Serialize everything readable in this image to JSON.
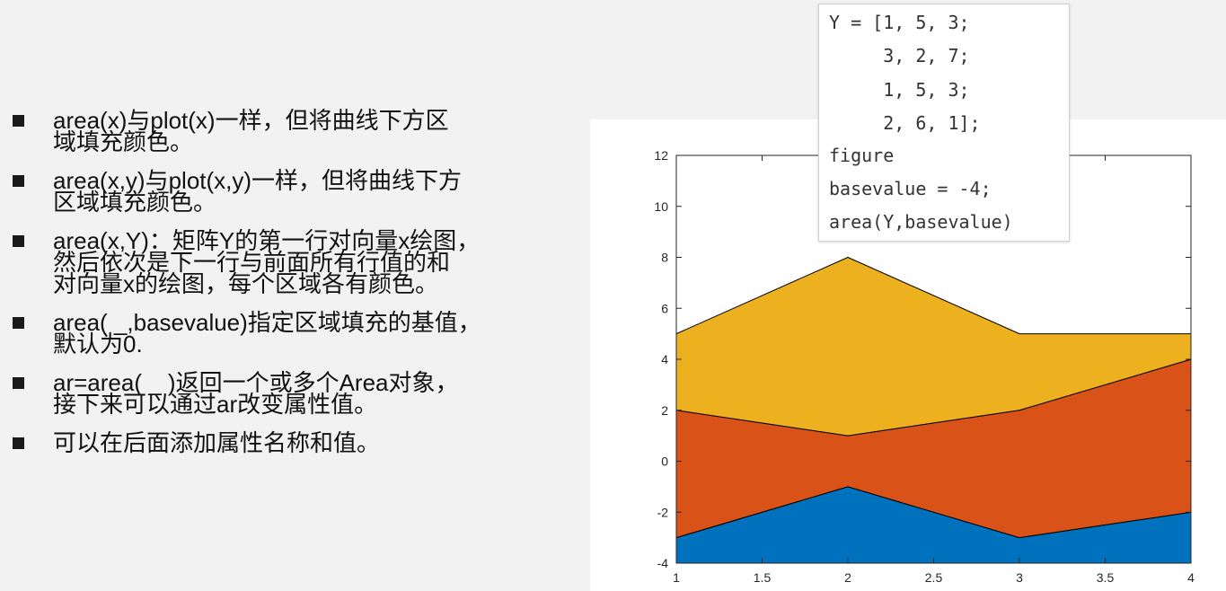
{
  "bullets": [
    "area(x)与plot(x)一样，但将曲线下方区\n域填充颜色。",
    "area(x,y)与plot(x,y)一样，但将曲线下方\n区域填充颜色。",
    "area(x,Y)：矩阵Y的第一行对向量x绘图，\n然后依次是下一行与前面所有行值的和\n对向量x的绘图，每个区域各有颜色。",
    "area( _,basevalue)指定区域填充的基值，\n默认为0.",
    "ar=area( _ )返回一个或多个Area对象，\n接下来可以通过ar改变属性值。",
    "可以在后面添加属性名称和值。"
  ],
  "code": [
    "Y = [1, 5, 3;",
    "     3, 2, 7;",
    "     1, 5, 3;",
    "     2, 6, 1];",
    "figure",
    "basevalue = -4;",
    "area(Y,basevalue)"
  ],
  "chart_data": {
    "type": "area",
    "stacked": true,
    "basevalue": -4,
    "x": [
      1,
      2,
      3,
      4
    ],
    "series": [
      {
        "values": [
          1,
          3,
          1,
          2
        ],
        "color": "#0072BD"
      },
      {
        "values": [
          5,
          2,
          5,
          6
        ],
        "color": "#D95319"
      },
      {
        "values": [
          3,
          7,
          3,
          1
        ],
        "color": "#EDB120"
      }
    ],
    "xlim": [
      1,
      4
    ],
    "ylim": [
      -4,
      12
    ],
    "xticks": [
      "1",
      "1.5",
      "2",
      "2.5",
      "3",
      "3.5",
      "4"
    ],
    "yticks": [
      "-4",
      "-2",
      "0",
      "2",
      "4",
      "6",
      "8",
      "10",
      "12"
    ],
    "grid": false
  }
}
